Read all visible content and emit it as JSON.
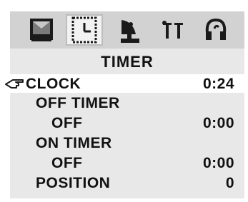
{
  "tabs": [
    {
      "icon": "picture-icon",
      "selected": false
    },
    {
      "icon": "clock-icon",
      "selected": true
    },
    {
      "icon": "satellite-dish-icon",
      "selected": false
    },
    {
      "icon": "tools-icon",
      "selected": false
    },
    {
      "icon": "audio-icon",
      "selected": false
    }
  ],
  "menu": {
    "title": "TIMER",
    "rows": [
      {
        "label": "CLOCK",
        "value": "0:24",
        "selected": true
      },
      {
        "label": "OFF TIMER",
        "value": ""
      },
      {
        "label": "OFF",
        "value": "0:00"
      },
      {
        "label": "ON TIMER",
        "value": ""
      },
      {
        "label": "OFF",
        "value": "0:00"
      },
      {
        "label": "POSITION",
        "value": "0"
      }
    ]
  },
  "cursor_icon": "pointing-hand-icon"
}
